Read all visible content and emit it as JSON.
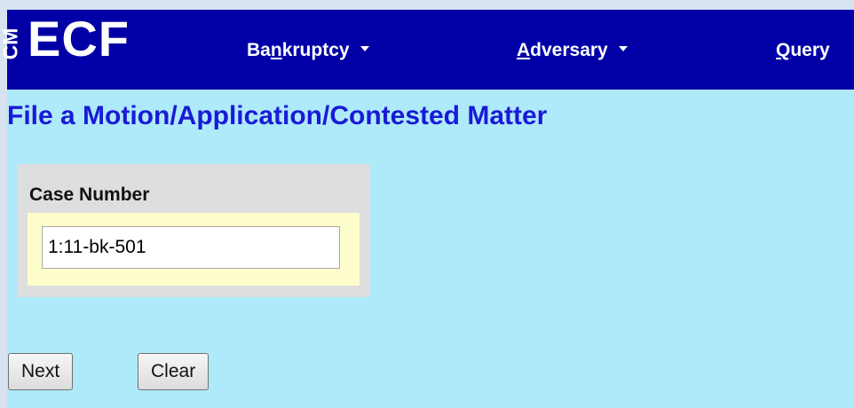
{
  "logo": {
    "cm": "CM",
    "ecf": "ECF"
  },
  "nav": {
    "bankruptcy": {
      "pre": "Ba",
      "accel": "n",
      "post": "kruptcy"
    },
    "adversary": {
      "pre": "",
      "accel": "A",
      "post": "dversary"
    },
    "query": {
      "pre": "",
      "accel": "Q",
      "post": "uery"
    }
  },
  "page": {
    "title": "File a Motion/Application/Contested Matter"
  },
  "form": {
    "case_number_label": "Case Number",
    "case_number_value": "1:11-bk-501"
  },
  "buttons": {
    "next": "Next",
    "clear": "Clear"
  },
  "colors": {
    "navbar": "#0000a6",
    "page_bg": "#aeeafa",
    "title": "#1a1ad6",
    "case_box": "#dedede",
    "case_inner": "#fefecc"
  }
}
